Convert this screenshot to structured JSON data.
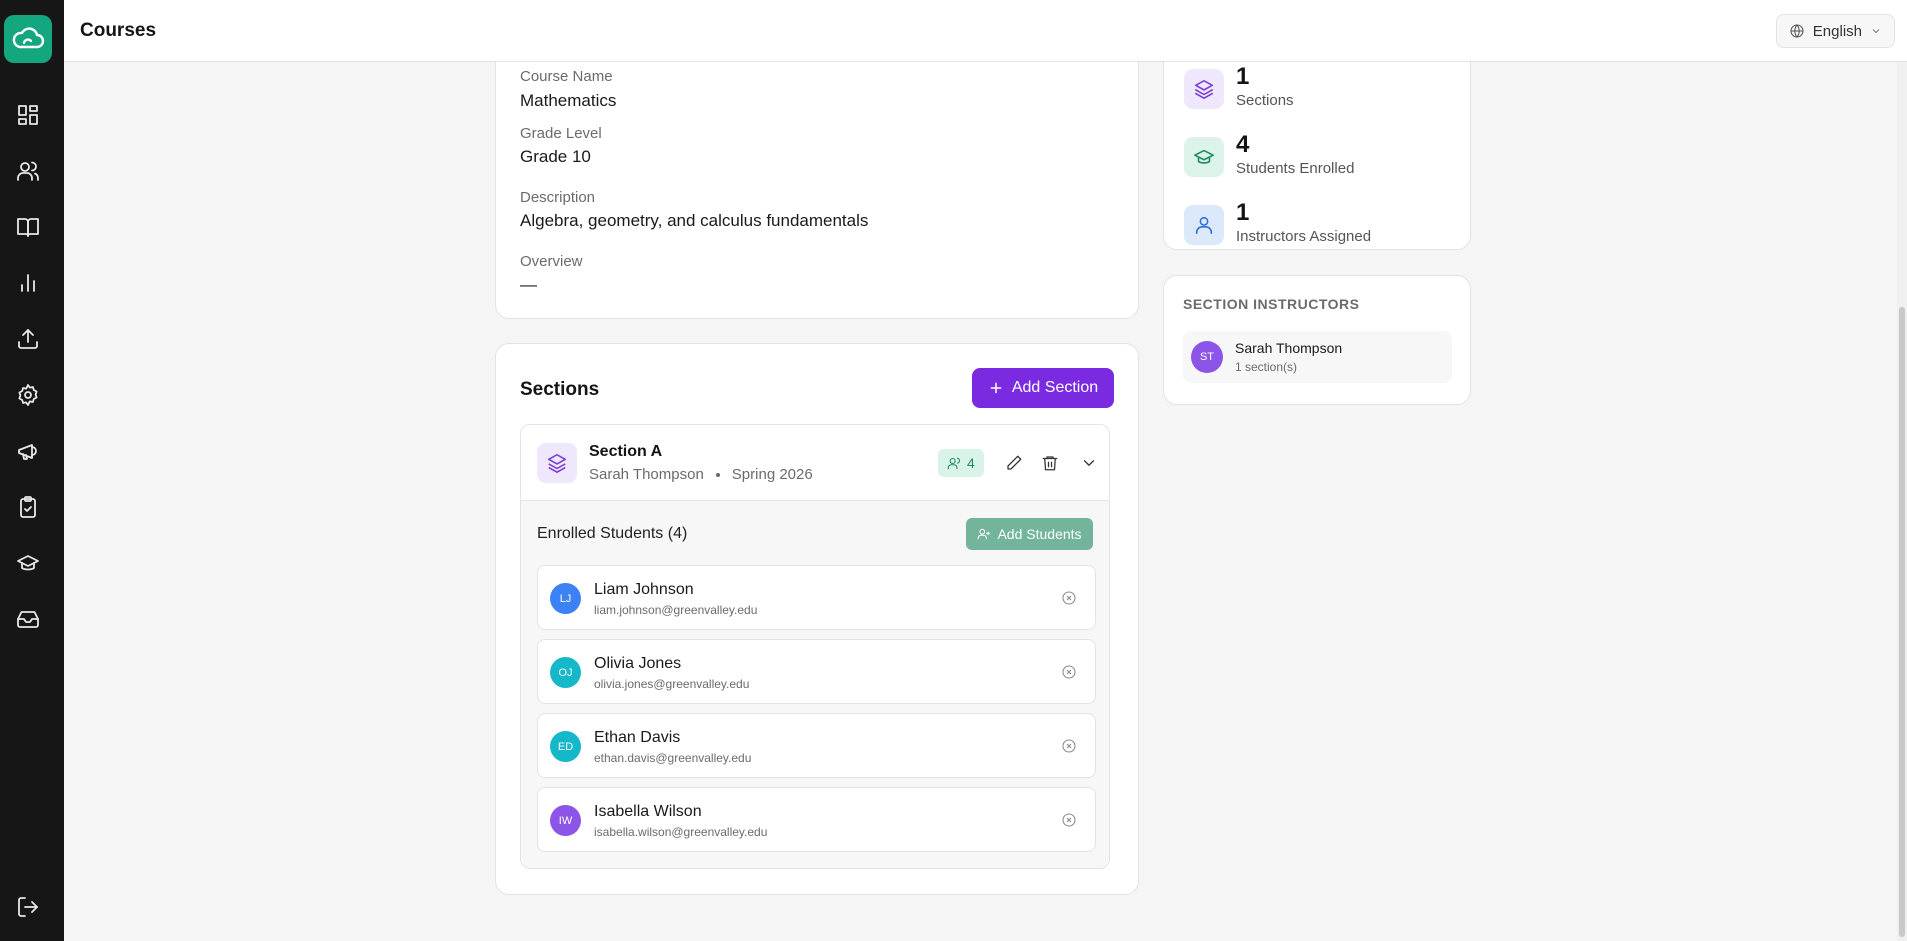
{
  "header": {
    "title": "Courses",
    "language": "English"
  },
  "sidebar": {
    "items": [
      {
        "name": "dashboard-icon"
      },
      {
        "name": "users-icon"
      },
      {
        "name": "book-icon"
      },
      {
        "name": "chart-icon"
      },
      {
        "name": "upload-icon"
      },
      {
        "name": "gear-icon"
      },
      {
        "name": "megaphone-icon"
      },
      {
        "name": "clipboard-check-icon"
      },
      {
        "name": "graduation-cap-icon"
      },
      {
        "name": "inbox-icon"
      }
    ],
    "logout": "logout-icon"
  },
  "course_info": {
    "course_name_label": "Course Name",
    "course_name": "Mathematics",
    "grade_level_label": "Grade Level",
    "grade_level": "Grade 10",
    "description_label": "Description",
    "description": "Algebra, geometry, and calculus fundamentals",
    "overview_label": "Overview",
    "overview": "—"
  },
  "stats": [
    {
      "value": "1",
      "label": "Sections"
    },
    {
      "value": "4",
      "label": "Students Enrolled"
    },
    {
      "value": "1",
      "label": "Instructors Assigned"
    }
  ],
  "sections_panel": {
    "title": "Sections",
    "add_button": "Add Section",
    "section": {
      "name": "Section A",
      "instructor": "Sarah Thompson",
      "term": "Spring 2026",
      "student_count": "4",
      "enrolled_title": "Enrolled Students (4)",
      "add_students_button": "Add Students",
      "students": [
        {
          "initials": "LJ",
          "name": "Liam Johnson",
          "email": "liam.johnson@greenvalley.edu",
          "color": "#3b82f6"
        },
        {
          "initials": "OJ",
          "name": "Olivia Jones",
          "email": "olivia.jones@greenvalley.edu",
          "color": "#14b8c8"
        },
        {
          "initials": "ED",
          "name": "Ethan Davis",
          "email": "ethan.davis@greenvalley.edu",
          "color": "#14b8c8"
        },
        {
          "initials": "IW",
          "name": "Isabella Wilson",
          "email": "isabella.wilson@greenvalley.edu",
          "color": "#8d54e8"
        }
      ]
    }
  },
  "section_instructors": {
    "title": "SECTION INSTRUCTORS",
    "items": [
      {
        "initials": "ST",
        "name": "Sarah Thompson",
        "sections": "1 section(s)"
      }
    ]
  },
  "colors": {
    "brand": "#13a67f",
    "primary": "#7a2be2",
    "sidebar": "#161616"
  }
}
